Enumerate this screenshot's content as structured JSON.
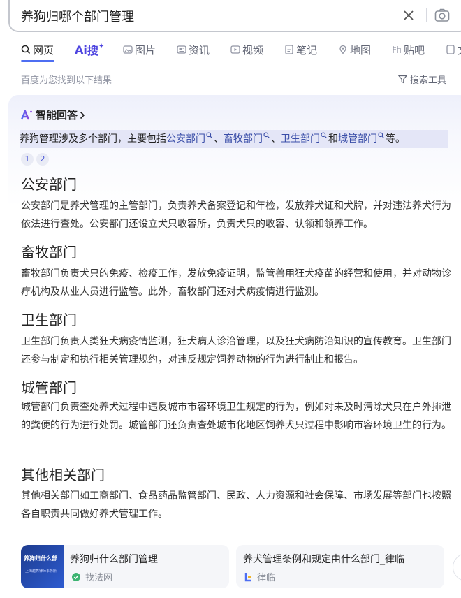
{
  "search": {
    "query": "养狗归哪个部门管理"
  },
  "tabs": [
    {
      "label": "网页",
      "icon": "search-icon"
    },
    {
      "label": "搜",
      "prefix": "Ai",
      "icon": "ai-icon"
    },
    {
      "label": "图片",
      "icon": "image-icon"
    },
    {
      "label": "资讯",
      "icon": "news-icon"
    },
    {
      "label": "视频",
      "icon": "video-icon"
    },
    {
      "label": "笔记",
      "icon": "note-icon"
    },
    {
      "label": "地图",
      "icon": "map-icon"
    },
    {
      "label": "贴吧",
      "icon": "tieba-icon"
    },
    {
      "label": "文",
      "icon": "doc-icon"
    }
  ],
  "result_hint": "百度为您找到以下结果",
  "search_tools": "搜索工具",
  "ai_answer": {
    "heading": "智能回答",
    "logo": "Ai",
    "summary": {
      "prefix": "养狗管理涉及多个部门，主要包括",
      "links": [
        "公安部门",
        "畜牧部门",
        "卫生部门",
        "城管部门"
      ],
      "sep1": "、",
      "sep2": "、",
      "sep3": "和",
      "suffix": "等。"
    },
    "citations": [
      "1",
      "2"
    ],
    "sections": [
      {
        "title": "公安部门",
        "body": "公安部门是养犬管理的主管部门，负责养犬备案登记和年检，发放养犬证和犬牌，并对违法养犬行为依法进行查处。公安部门还设立犬只收容所，负责犬只的收容、认领和领养工作。"
      },
      {
        "title": "畜牧部门",
        "body": "畜牧部门负责犬只的免疫、检疫工作，发放免疫证明，监管兽用狂犬疫苗的经营和使用，并对动物诊疗机构及从业人员进行监管。此外，畜牧部门还对犬病疫情进行监测。"
      },
      {
        "title": "卫生部门",
        "body": "卫生部门负责人类狂犬病疫情监测，狂犬病人诊治管理，以及狂犬病防治知识的宣传教育。卫生部门还参与制定和执行相关管理规约，对违反规定饲养动物的行为进行制止和报告。"
      },
      {
        "title": "城管部门",
        "body": "城管部门负责查处养犬过程中违反城市市容环境卫生规定的行为，例如对未及时清除犬只在户外排泄的粪便的行为进行处罚。城管部门还负责查处城市化地区饲养犬只过程中影响市容环境卫生的行为。"
      },
      {
        "title": "其他相关部门",
        "body": "其他相关部门如工商部门、食品药品监管部门、民政、人力资源和社会保障、市场发展等部门也按照各自职责共同做好养犬管理工作。"
      }
    ]
  },
  "related": [
    {
      "title": "养狗归什么部门管理",
      "source": "找法网",
      "thumb_title": "养狗归什么部",
      "thumb_sub": "上海越秀律师事务所"
    },
    {
      "title": "养犬管理条例和规定由什么部门_律临",
      "source": "律临"
    }
  ],
  "colors": {
    "accent": "#4e6ef2",
    "ai_purple": "#4e45e0",
    "link": "#3a4ea8"
  }
}
